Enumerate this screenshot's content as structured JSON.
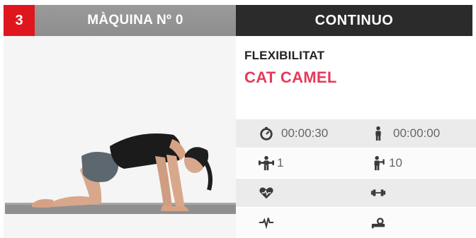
{
  "header": {
    "step_number": "3",
    "machine_title": "MÀQUINA Nº 0",
    "mode": "CONTINUO"
  },
  "exercise": {
    "category": "FLEXIBILITAT",
    "name": "CAT CAMEL"
  },
  "stats": {
    "duration": "00:00:30",
    "rest": "00:00:00",
    "sets": "1",
    "reps": "10"
  },
  "colors": {
    "accent_red": "#e0161e",
    "exercise_pink": "#e63a5a",
    "header_dark": "#2b2b2b",
    "header_grey": "#949494"
  },
  "icons": {
    "duration": "stopwatch-icon",
    "rest": "standing-person-icon",
    "sets": "sets-person-icon",
    "reps": "reps-person-icon",
    "heart_rate": "heart-icon",
    "weight": "dumbbell-icon",
    "pulse": "pulse-icon",
    "speed": "incline-icon"
  }
}
